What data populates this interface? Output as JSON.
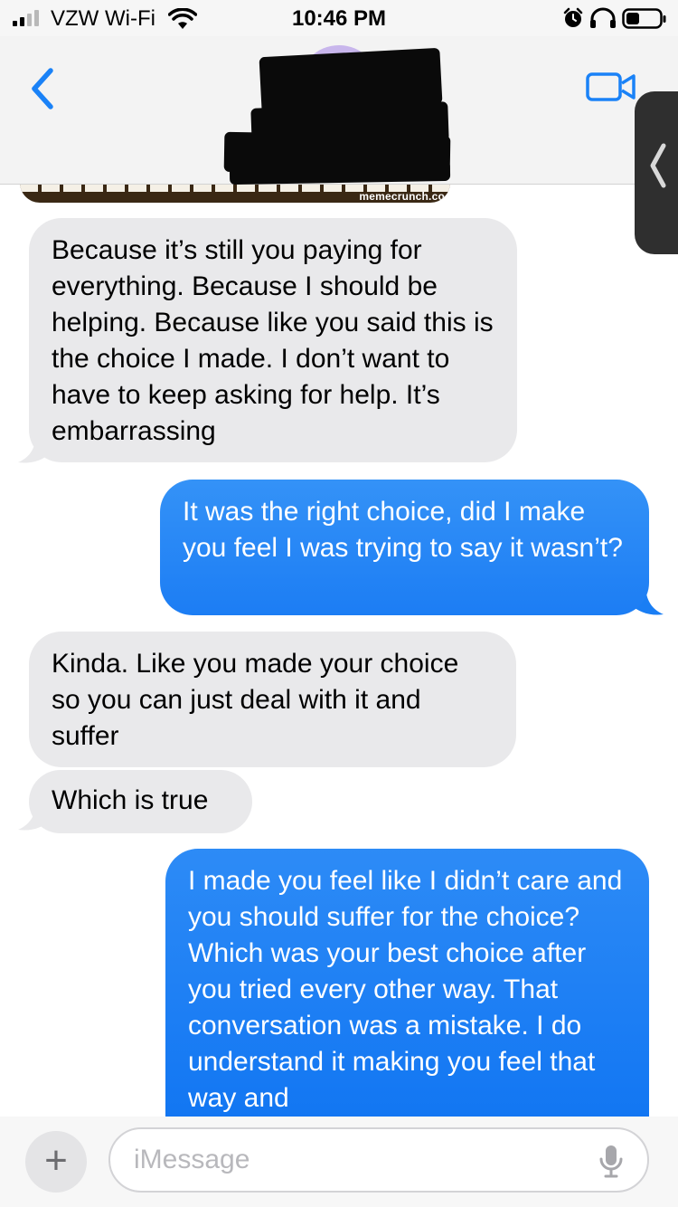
{
  "status_bar": {
    "carrier": "VZW Wi-Fi",
    "time": "10:46 PM"
  },
  "header": {
    "icons": [
      "chevron-left-icon",
      "video-camera-icon",
      "chevron-left-icon"
    ]
  },
  "meme": {
    "watermark": "memecrunch.co"
  },
  "messages": [
    {
      "direction": "received",
      "text": "Because it’s still you paying for everything. Because I should be helping. Because like you said this is the choice I made. I don’t want to have to keep asking for help. It’s embarrassing"
    },
    {
      "direction": "sent",
      "text": "It was the right choice, did I make you feel I was trying to say it wasn’t?"
    },
    {
      "direction": "received",
      "text": "Kinda. Like you made your choice so you can just deal with it and suffer"
    },
    {
      "direction": "received",
      "text": "Which is true"
    },
    {
      "direction": "sent",
      "text": "I made you feel like I didn’t care and you should suffer for the choice?  Which was your best choice after you tried every other way.     That conversation was a mistake. I do understand it making you feel that way and"
    }
  ],
  "input_bar": {
    "placeholder": "iMessage",
    "plus_label": "+"
  },
  "colors": {
    "received_bubble": "#e9e9eb",
    "sent_bubble_top": "#2c8cf6",
    "sent_bubble_bottom": "#0f74f2",
    "ios_blue": "#0a84ff"
  }
}
